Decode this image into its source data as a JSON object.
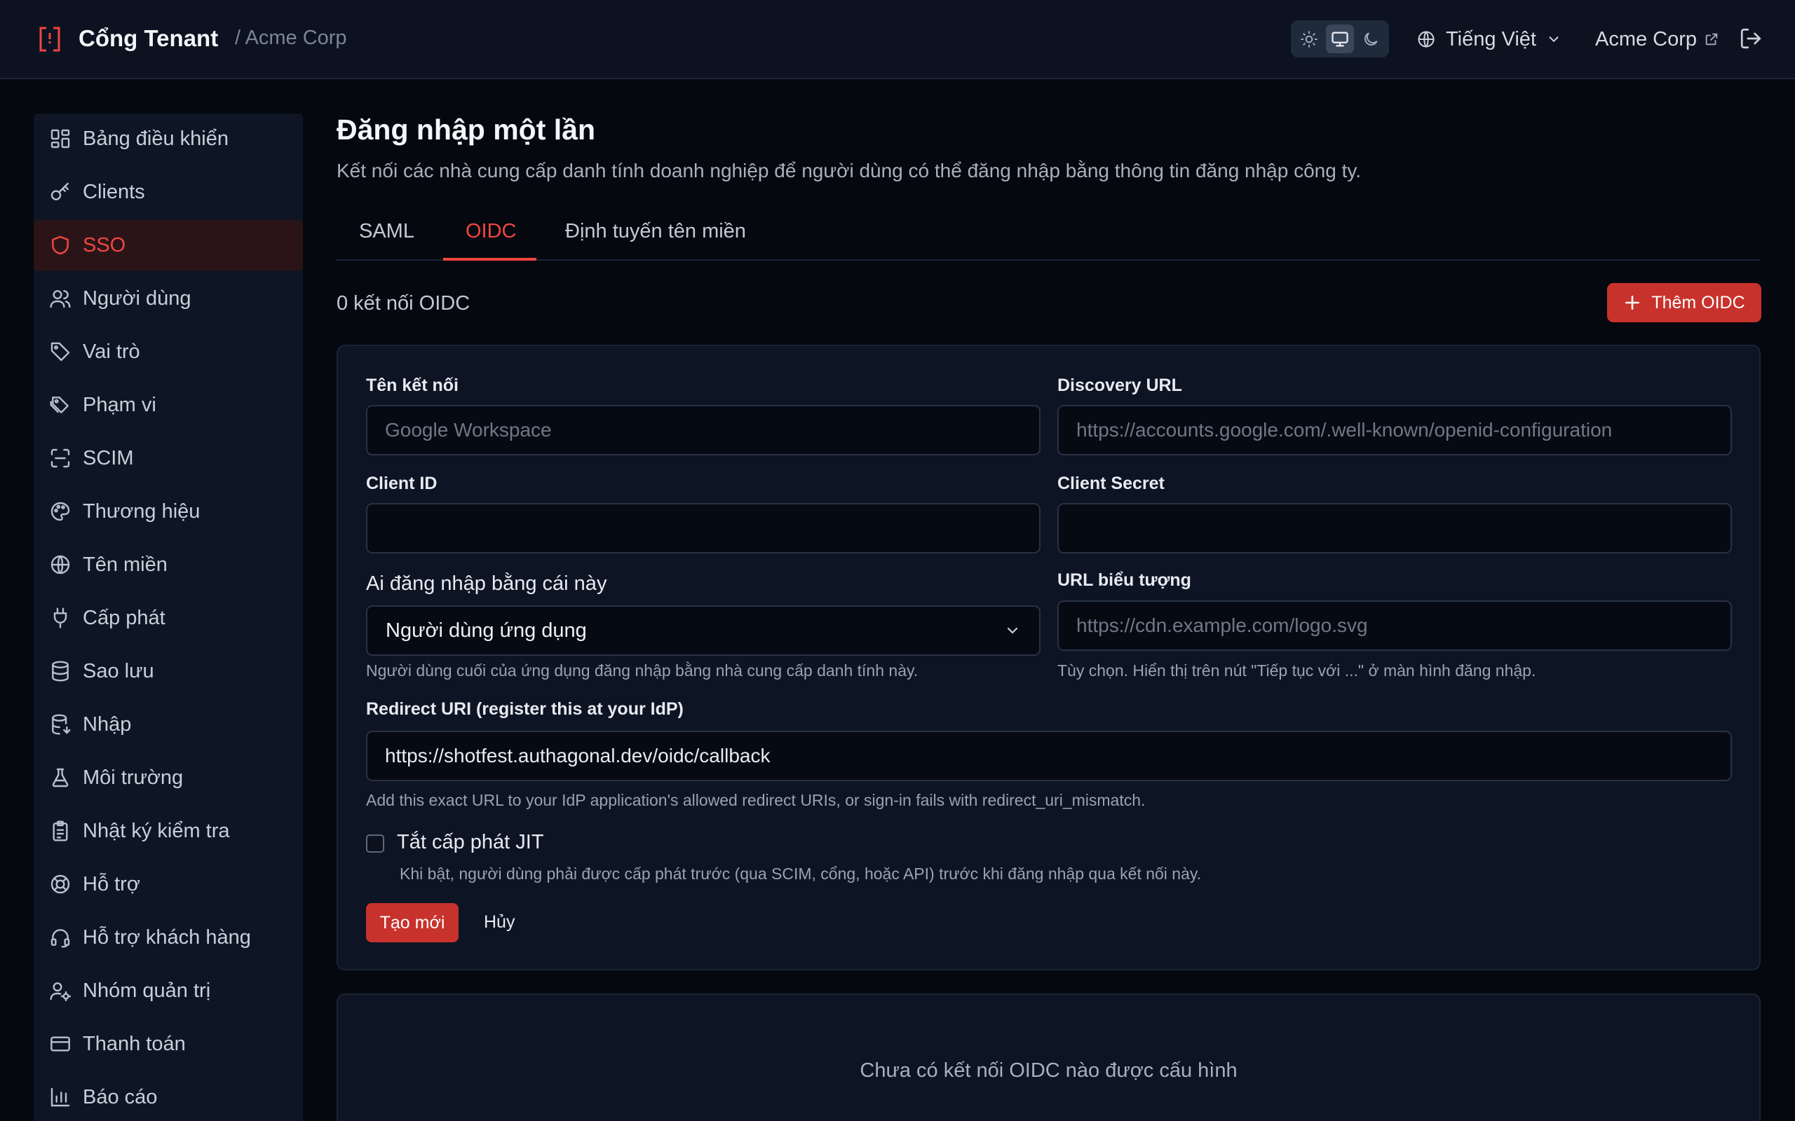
{
  "header": {
    "app_title": "Cổng Tenant",
    "breadcrumb": "/ Acme Corp",
    "theme_modes": [
      "light",
      "system",
      "dark"
    ],
    "theme_active": "system",
    "language": "Tiếng Việt",
    "tenant_name": "Acme Corp"
  },
  "sidebar": {
    "items": [
      {
        "label": "Bảng điều khiển",
        "icon": "dashboard-icon"
      },
      {
        "label": "Clients",
        "icon": "key-icon"
      },
      {
        "label": "SSO",
        "icon": "shield-icon",
        "active": true
      },
      {
        "label": "Người dùng",
        "icon": "users-icon"
      },
      {
        "label": "Vai trò",
        "icon": "tag-icon"
      },
      {
        "label": "Phạm vi",
        "icon": "tags-icon"
      },
      {
        "label": "SCIM",
        "icon": "scan-icon"
      },
      {
        "label": "Thương hiệu",
        "icon": "palette-icon"
      },
      {
        "label": "Tên miền",
        "icon": "globe-icon"
      },
      {
        "label": "Cấp phát",
        "icon": "plug-icon"
      },
      {
        "label": "Sao lưu",
        "icon": "database-icon"
      },
      {
        "label": "Nhập",
        "icon": "database-import-icon"
      },
      {
        "label": "Môi trường",
        "icon": "flask-icon"
      },
      {
        "label": "Nhật ký kiểm tra",
        "icon": "clipboard-icon"
      },
      {
        "label": "Hỗ trợ",
        "icon": "lifebuoy-icon"
      },
      {
        "label": "Hỗ trợ khách hàng",
        "icon": "headset-icon"
      },
      {
        "label": "Nhóm quản trị",
        "icon": "user-cog-icon"
      },
      {
        "label": "Thanh toán",
        "icon": "credit-card-icon"
      },
      {
        "label": "Báo cáo",
        "icon": "bar-chart-icon"
      }
    ]
  },
  "main": {
    "title": "Đăng nhập một lần",
    "subtitle": "Kết nối các nhà cung cấp danh tính doanh nghiệp để người dùng có thể đăng nhập bằng thông tin đăng nhập công ty.",
    "tabs": [
      {
        "label": "SAML",
        "active": false
      },
      {
        "label": "OIDC",
        "active": true
      },
      {
        "label": "Định tuyến tên miền",
        "active": false
      }
    ],
    "count_label": "0 kết nối OIDC",
    "add_button": "Thêm OIDC",
    "form": {
      "connection_name": {
        "label": "Tên kết nối",
        "placeholder": "Google Workspace",
        "value": ""
      },
      "discovery_url": {
        "label": "Discovery URL",
        "placeholder": "https://accounts.google.com/.well-known/openid-configuration",
        "value": ""
      },
      "client_id": {
        "label": "Client ID",
        "placeholder": "",
        "value": ""
      },
      "client_secret": {
        "label": "Client Secret",
        "placeholder": "",
        "value": ""
      },
      "audience": {
        "label": "Ai đăng nhập bằng cái này",
        "value": "Người dùng ứng dụng",
        "hint": "Người dùng cuối của ứng dụng đăng nhập bằng nhà cung cấp danh tính này."
      },
      "icon_url": {
        "label": "URL biểu tượng",
        "placeholder": "https://cdn.example.com/logo.svg",
        "value": "",
        "hint": "Tùy chọn. Hiển thị trên nút \"Tiếp tục với ...\" ở màn hình đăng nhập."
      },
      "redirect_uri": {
        "label": "Redirect URI (register this at your IdP)",
        "value": "https://shotfest.authagonal.dev/oidc/callback",
        "hint": "Add this exact URL to your IdP application's allowed redirect URIs, or sign-in fails with redirect_uri_mismatch."
      },
      "jit": {
        "label": "Tắt cấp phát JIT",
        "checked": false,
        "hint": "Khi bật, người dùng phải được cấp phát trước (qua SCIM, cổng, hoặc API) trước khi đăng nhập qua kết nối này."
      },
      "create_button": "Tạo mới",
      "cancel_button": "Hủy"
    },
    "empty_state": "Chưa có kết nối OIDC nào được cấu hình"
  },
  "colors": {
    "accent": "#f0463f",
    "button": "#c8322c",
    "background": "#05080f",
    "surface": "#0d1424"
  }
}
